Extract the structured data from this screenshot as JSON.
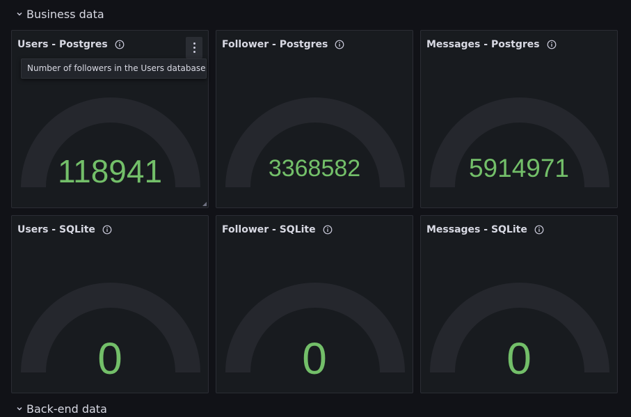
{
  "section": {
    "title": "Business data"
  },
  "next_section": {
    "title": "Back-end data"
  },
  "tooltip": {
    "text": "Number of followers in the Users database"
  },
  "colors": {
    "value": "#73bf69",
    "arc": "#25272d",
    "panel": "#181b1f"
  },
  "panels": [
    {
      "title": "Users - Postgres",
      "value": "118941"
    },
    {
      "title": "Follower - Postgres",
      "value": "3368582"
    },
    {
      "title": "Messages - Postgres",
      "value": "5914971"
    },
    {
      "title": "Users - SQLite",
      "value": "0"
    },
    {
      "title": "Follower - SQLite",
      "value": "0"
    },
    {
      "title": "Messages - SQLite",
      "value": "0"
    }
  ]
}
